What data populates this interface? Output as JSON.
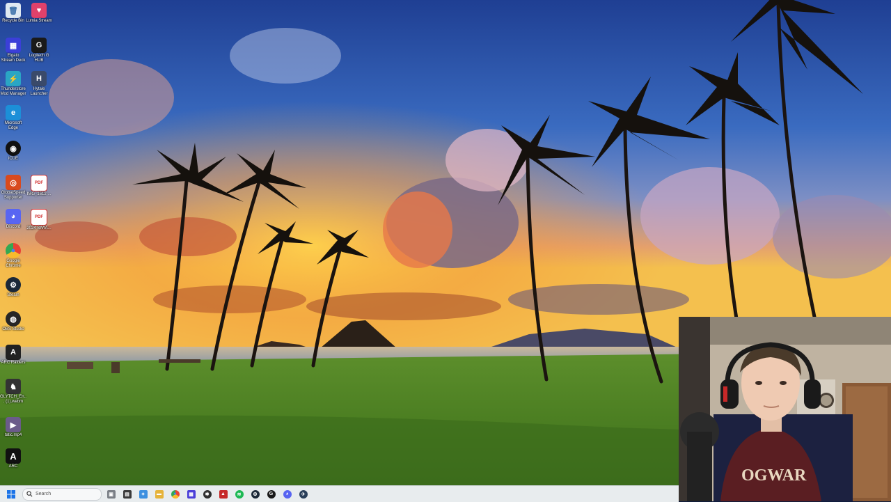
{
  "desktop": {
    "icons": [
      {
        "label": "Recycle Bin",
        "icon": "recycle-bin-icon",
        "color": "#dfe9f2",
        "glyph": "🗑"
      },
      {
        "label": "Lumia Stream",
        "icon": "lumia-stream-icon",
        "color": "#e0416b",
        "glyph": "♥"
      },
      {
        "label": "Elgato Stream Deck",
        "icon": "stream-deck-icon",
        "color": "#3b3fd8",
        "glyph": "▦"
      },
      {
        "label": "Logitech G HUB",
        "icon": "logitech-ghub-icon",
        "color": "#1a1a1a",
        "glyph": "G"
      },
      {
        "label": "Thunderstore Mod Manager",
        "icon": "thunderstore-icon",
        "color": "#2aa6c4",
        "glyph": "⚡"
      },
      {
        "label": "Hytale Launcher",
        "icon": "hytale-launcher-icon",
        "color": "#3a4a6a",
        "glyph": "H"
      },
      {
        "label": "Microsoft Edge",
        "icon": "edge-icon",
        "color": "#1c8fd8",
        "glyph": "e"
      },
      {
        "label": "iCUE",
        "icon": "icue-icon",
        "color": "#111111",
        "glyph": "◉"
      },
      {
        "label": "GlobalSpeed Supporter",
        "icon": "speed-app-icon",
        "color": "#d94a1e",
        "glyph": "◎"
      },
      {
        "label": "IMG_1612 ...",
        "icon": "pdf-icon",
        "color": "#d32f2f",
        "glyph": "PDF"
      },
      {
        "label": "Discord",
        "icon": "discord-icon",
        "color": "#5865f2",
        "glyph": "◕"
      },
      {
        "label": "2024 SIVIA...",
        "icon": "pdf-icon",
        "color": "#d32f2f",
        "glyph": "PDF"
      },
      {
        "label": "Google Chrome",
        "icon": "chrome-icon",
        "color": "#e94235",
        "glyph": "●"
      },
      {
        "label": "Steam",
        "icon": "steam-icon",
        "color": "#1b2838",
        "glyph": "⚙"
      },
      {
        "label": "OBS Studio",
        "icon": "obs-icon",
        "color": "#262626",
        "glyph": "◍"
      },
      {
        "label": "ARC Raiders",
        "icon": "arc-raiders-icon",
        "color": "#222222",
        "glyph": "A"
      },
      {
        "label": "GLYTCH_En... (1).webm",
        "icon": "video-file-icon",
        "color": "#333333",
        "glyph": "♞"
      },
      {
        "label": "tatic.mp4",
        "icon": "video-file-icon",
        "color": "#6b5b8a",
        "glyph": "▶"
      },
      {
        "label": "ARC",
        "icon": "arc-icon",
        "color": "#111111",
        "glyph": "A"
      }
    ]
  },
  "taskbar": {
    "search_placeholder": "Search",
    "apps": [
      {
        "name": "task-view-icon",
        "color": "#7a7f86",
        "glyph": "▣"
      },
      {
        "name": "file-explorer-icon",
        "color": "#3a3a3a",
        "glyph": "▤"
      },
      {
        "name": "copilot-icon",
        "color": "#3b8fe0",
        "glyph": "✦"
      },
      {
        "name": "folder-icon",
        "color": "#e6b33a",
        "glyph": "▬"
      },
      {
        "name": "chrome-icon",
        "color": "#e94235",
        "glyph": "●"
      },
      {
        "name": "stream-deck-icon",
        "color": "#4b3fd8",
        "glyph": "▦"
      },
      {
        "name": "xsplit-icon",
        "color": "#2f2f2f",
        "glyph": "✱"
      },
      {
        "name": "pdf-reader-icon",
        "color": "#c62828",
        "glyph": "▲"
      },
      {
        "name": "spotify-icon",
        "color": "#1db954",
        "glyph": "≋"
      },
      {
        "name": "steam-icon",
        "color": "#1b2838",
        "glyph": "⚙"
      },
      {
        "name": "logitech-ghub-icon",
        "color": "#1a1a1a",
        "glyph": "G"
      },
      {
        "name": "discord-icon",
        "color": "#5865f2",
        "glyph": "◕"
      },
      {
        "name": "steam-alt-icon",
        "color": "#2a3f5a",
        "glyph": "✈"
      }
    ]
  }
}
